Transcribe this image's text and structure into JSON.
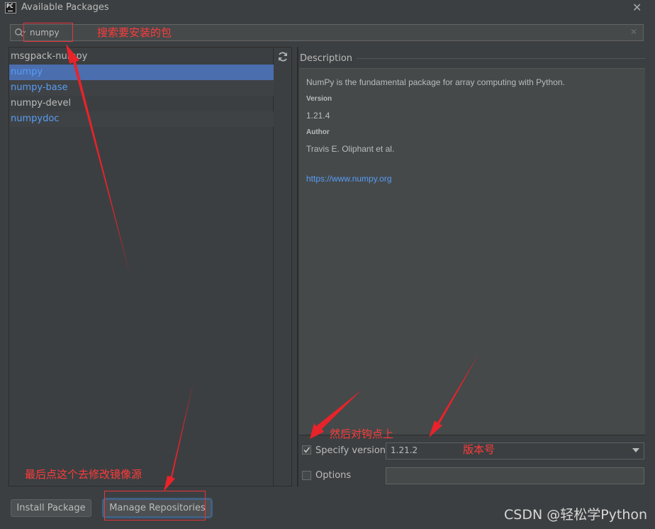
{
  "window": {
    "title": "Available Packages",
    "app_icon_text": "PC",
    "close_icon": "close-icon"
  },
  "search": {
    "value": "numpy",
    "icon": "search-icon",
    "clear_icon": "clear-icon"
  },
  "packages": [
    {
      "name": "msgpack-numpy",
      "selected": false,
      "link": false
    },
    {
      "name": "numpy",
      "selected": true,
      "link": true
    },
    {
      "name": "numpy-base",
      "selected": false,
      "link": true
    },
    {
      "name": "numpy-devel",
      "selected": false,
      "link": false
    },
    {
      "name": "numpydoc",
      "selected": false,
      "link": true
    }
  ],
  "refresh_icon": "refresh-icon",
  "description": {
    "label": "Description",
    "summary": "NumPy is the fundamental package for array computing with Python.",
    "version_heading": "Version",
    "version": "1.21.4",
    "author_heading": "Author",
    "author": "Travis E. Oliphant et al.",
    "url": "https://www.numpy.org"
  },
  "options": {
    "specify_version_label": "Specify version",
    "specify_version_checked": true,
    "selected_version": "1.21.2",
    "options_label": "Options",
    "options_checked": false,
    "options_value": ""
  },
  "buttons": {
    "install": "Install Package",
    "manage": "Manage Repositories"
  },
  "annotations": {
    "search_note": "搜索要安装的包",
    "check_note": "然后对钩点上",
    "version_note": "版本号",
    "mirror_note": "最后点这个去修改镜像源"
  },
  "watermark": "CSDN @轻松学Python",
  "colors": {
    "background": "#3c3f41",
    "selection": "#4b6eaf",
    "link": "#589df6",
    "annotation": "#ff3b3b"
  }
}
